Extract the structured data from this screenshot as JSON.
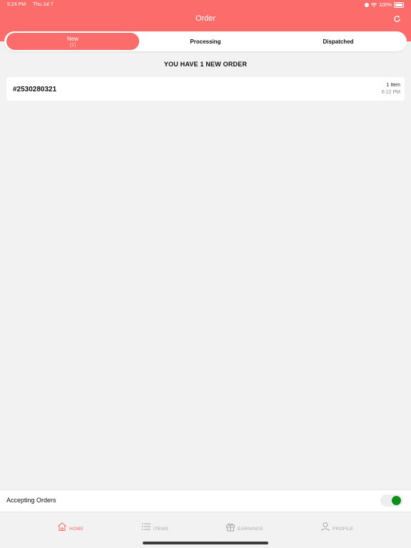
{
  "status_bar": {
    "time": "5:24 PM",
    "date": "Thu Jul 7",
    "battery": "100%"
  },
  "header": {
    "title": "Order"
  },
  "tabs": [
    {
      "label": "New",
      "count": "(1)"
    },
    {
      "label": "Processing"
    },
    {
      "label": "Dispatched"
    }
  ],
  "headline": "YOU HAVE 1 NEW ORDER",
  "orders": [
    {
      "id": "#2530280321",
      "items": "1 Item",
      "time": "6:12 PM"
    }
  ],
  "accepting": {
    "label": "Accepting Orders",
    "enabled": true,
    "on_color": "#0e8f1a"
  },
  "tabbar": {
    "items": [
      {
        "label": "HOME",
        "icon": "home-icon",
        "active": true
      },
      {
        "label": "ITEMS",
        "icon": "list-icon",
        "active": false
      },
      {
        "label": "EARNINGS",
        "icon": "gift-icon",
        "active": false
      },
      {
        "label": "PROFILE",
        "icon": "user-icon",
        "active": false
      }
    ]
  },
  "colors": {
    "accent": "#fc6c6b",
    "background": "#f2f2f2"
  }
}
